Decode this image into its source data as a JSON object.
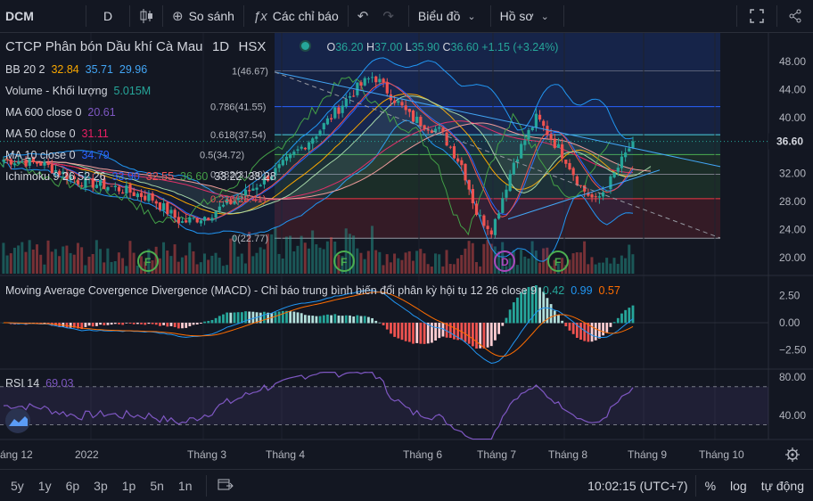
{
  "toolbar": {
    "symbol": "DCM",
    "interval": "D",
    "compare": "So sánh",
    "indicators": "Các chỉ báo",
    "chart_type": "Biểu đồ",
    "profile": "Hồ sơ"
  },
  "legend": {
    "title": "CTCP Phân bón Dầu khí Cà Mau",
    "interval": "1D",
    "exchange": "HSX",
    "ohlc": {
      "o_label": "O",
      "o": "36.20",
      "h_label": "H",
      "h": "37.00",
      "l_label": "L",
      "l": "35.90",
      "c_label": "C",
      "c": "36.60",
      "change": "+1.15 (+3.24%)"
    },
    "bb": {
      "label": "BB 20 2",
      "v1": "32.84",
      "v2": "35.71",
      "v3": "29.96"
    },
    "volume": {
      "label": "Volume - Khối lượng",
      "v": "5.015M"
    },
    "ma600": {
      "label": "MA 600 close 0",
      "v": "20.61"
    },
    "ma50": {
      "label": "MA 50 close 0",
      "v": "31.11"
    },
    "ma10": {
      "label": "MA 10 close 0",
      "v": "34.79"
    },
    "ichimoku": {
      "label": "Ichimoku 9 26 52 26",
      "v1": "33.90",
      "v2": "32.55",
      "v3": "36.60",
      "v4": "33.22",
      "v5": "33.28"
    }
  },
  "fib": {
    "l1": "1(46.67)",
    "l0786": "0.786(41.55)",
    "l0618": "0.618(37.54)",
    "l05": "0.5(34.72)",
    "l0382": "0.382(31.90)",
    "l0236": "0.236(28.41)",
    "l0": "0(22.77)"
  },
  "price_axis": [
    "48.00",
    "44.00",
    "40.00",
    "36.00",
    "32.00",
    "28.00",
    "24.00",
    "20.00"
  ],
  "last_price": "36.60",
  "macd": {
    "label": "Moving Average Covergence Divergence (MACD) - Chỉ báo trung bình biến đổi phân kỳ hội tụ 12 26 close 9",
    "v1": "0.42",
    "v2": "0.99",
    "v3": "0.57",
    "axis": [
      "2.50",
      "0.00",
      "−2.50"
    ]
  },
  "rsi": {
    "label": "RSI 14",
    "v": "69.03",
    "axis": [
      "80.00",
      "40.00"
    ]
  },
  "time_axis": [
    "áng 12",
    "2022",
    "Tháng 3",
    "Tháng 4",
    "Tháng 6",
    "Tháng 7",
    "Tháng 8",
    "Tháng 9",
    "Tháng 10"
  ],
  "markers": [
    "F",
    "F",
    "D",
    "F"
  ],
  "bottom": {
    "ranges": [
      "5y",
      "1y",
      "6p",
      "3p",
      "1p",
      "5n",
      "1n"
    ],
    "time": "10:02:15 (UTC+7)",
    "percent": "%",
    "log": "log",
    "auto": "tự động"
  },
  "colors": {
    "up": "#26a69a",
    "down": "#ef5350",
    "bb": "#2962ff",
    "ma": "#f7a600",
    "rsi": "#7e57c2"
  }
}
